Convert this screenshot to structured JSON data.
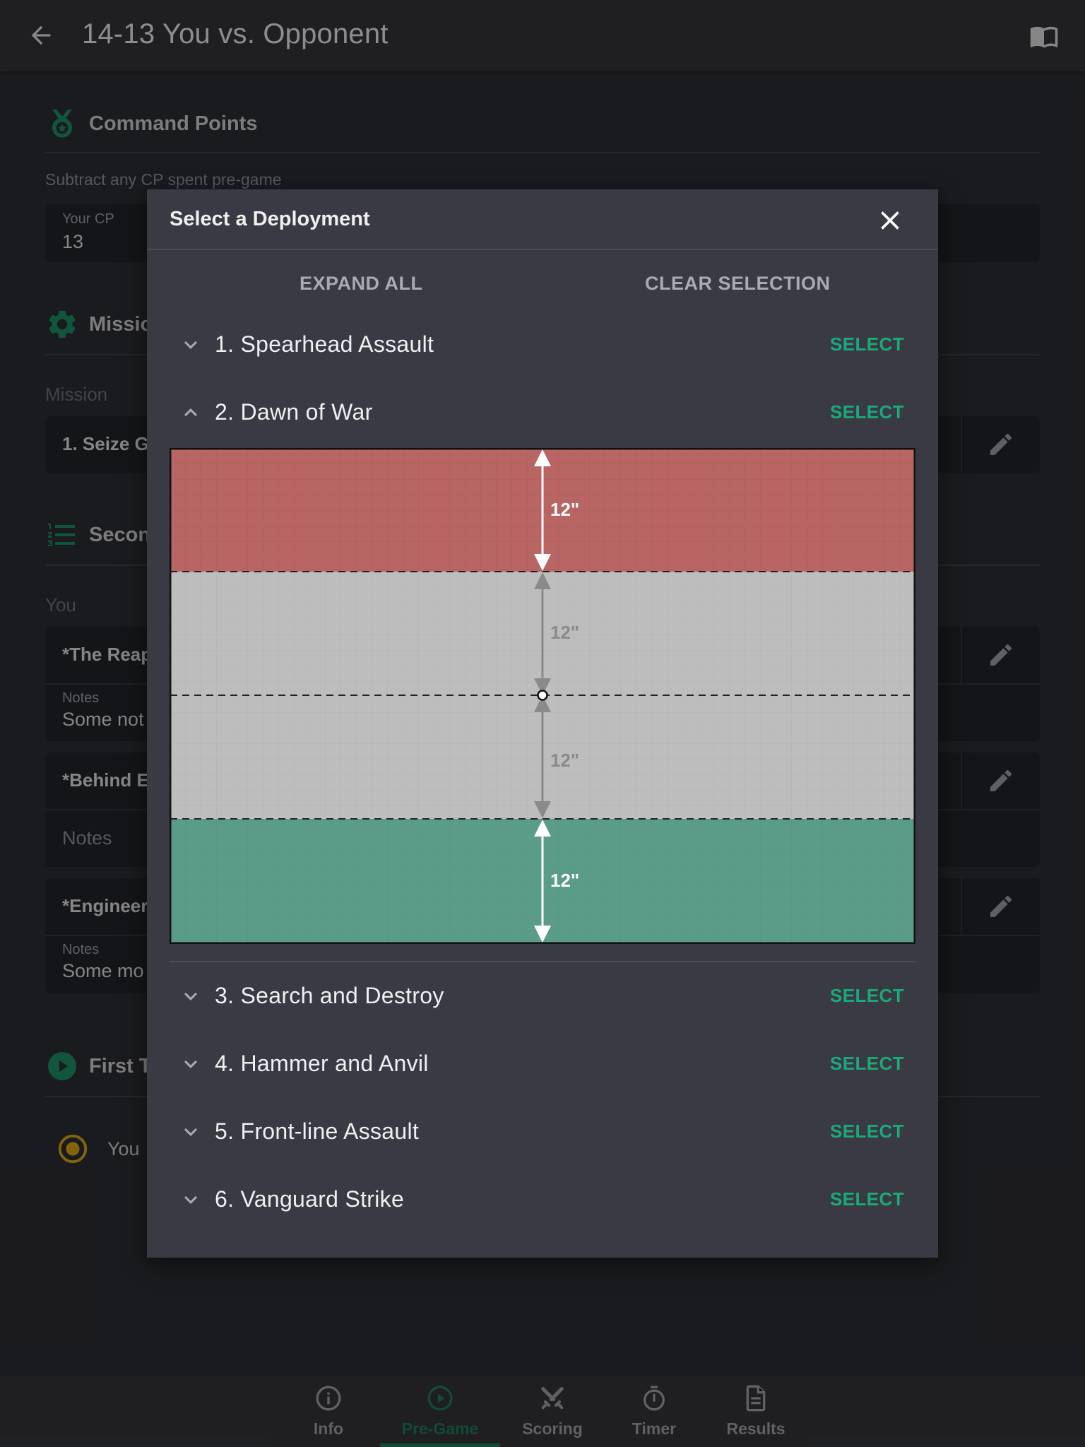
{
  "header": {
    "title": "14-13 You vs. Opponent"
  },
  "background": {
    "command_points": {
      "heading": "Command Points",
      "hint": "Subtract any CP spent pre-game",
      "your_cp_label": "Your CP",
      "your_cp_value": "13"
    },
    "mission": {
      "heading": "Missio",
      "label": "Mission",
      "value": "1. Seize G"
    },
    "secondaries": {
      "heading": "Secon",
      "you_label": "You",
      "items": [
        {
          "name": "*The Reap",
          "notes_label": "Notes",
          "notes_value": "Some not"
        },
        {
          "name": "*Behind E",
          "notes_placeholder": "Notes"
        },
        {
          "name": "*Engineer",
          "notes_label": "Notes",
          "notes_value": "Some mo"
        }
      ]
    },
    "first_turn": {
      "heading": "First T",
      "option_you": "You"
    }
  },
  "dialog": {
    "title": "Select a Deployment",
    "expand_all": "EXPAND ALL",
    "clear_selection": "CLEAR SELECTION",
    "select_label": "SELECT",
    "deployments": [
      {
        "label": "1. Spearhead Assault",
        "expanded": false
      },
      {
        "label": "2. Dawn of War",
        "expanded": true
      },
      {
        "label": "3. Search and Destroy",
        "expanded": false
      },
      {
        "label": "4. Hammer and Anvil",
        "expanded": false
      },
      {
        "label": "5. Front-line Assault",
        "expanded": false
      },
      {
        "label": "6. Vanguard Strike",
        "expanded": false
      }
    ],
    "map": {
      "measurements": [
        "12\"",
        "12\"",
        "12\"",
        "12\""
      ],
      "zone_colors": {
        "top": "#b86564",
        "neutral": "#bdbdbd",
        "bottom": "#5b9c89"
      }
    }
  },
  "nav": {
    "items": [
      {
        "label": "Info",
        "icon": "info-icon"
      },
      {
        "label": "Pre-Game",
        "icon": "play-icon",
        "active": true
      },
      {
        "label": "Scoring",
        "icon": "swords-icon"
      },
      {
        "label": "Timer",
        "icon": "stopwatch-icon"
      },
      {
        "label": "Results",
        "icon": "document-icon"
      }
    ]
  },
  "colors": {
    "accent": "#1aaa77",
    "nav_active": "#1c7a58",
    "radio": "#d4a017"
  }
}
